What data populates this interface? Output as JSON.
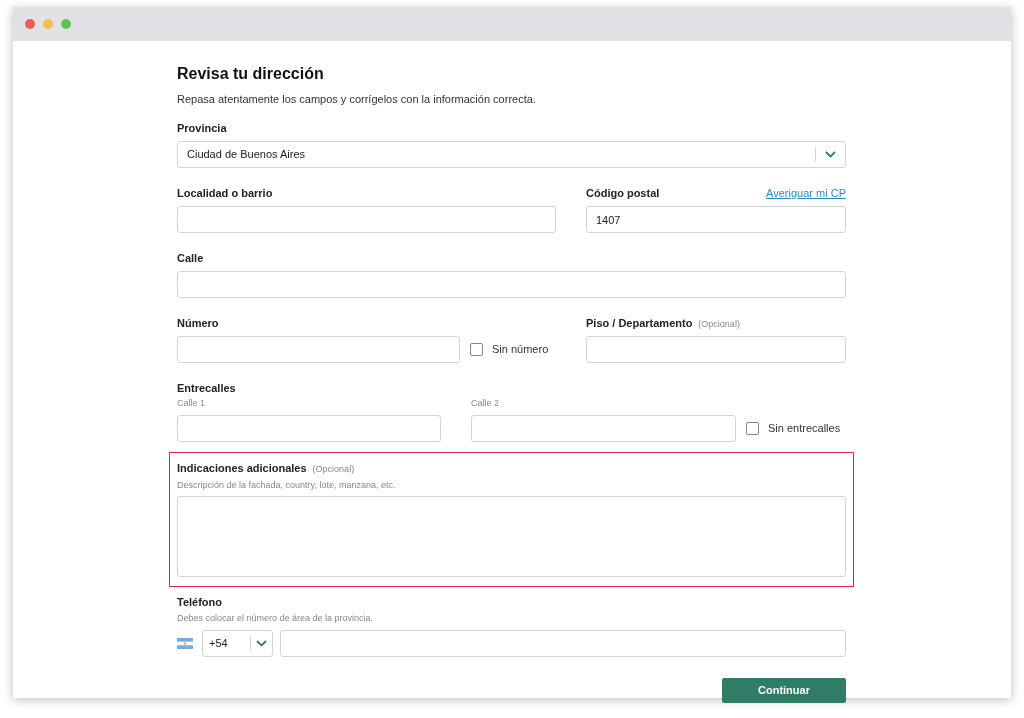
{
  "title": "Revisa tu dirección",
  "subtitle": "Repasa atentamente los campos y corrígelos con la información correcta.",
  "province": {
    "label": "Provincia",
    "value": "Ciudad de Buenos Aires"
  },
  "locality": {
    "label": "Localidad o barrio"
  },
  "postal_code": {
    "label": "Código postal",
    "value": "1407",
    "link": "Averiguar mi CP"
  },
  "street": {
    "label": "Calle"
  },
  "number": {
    "label": "Número",
    "no_number": {
      "label": "Sin número",
      "checked": false
    }
  },
  "floor": {
    "label": "Piso / Departamento",
    "optional": "(Opcional)"
  },
  "cross_streets": {
    "label": "Entrecalles",
    "street_1": "Calle 1",
    "street_2": "Calle 2",
    "none": {
      "label": "Sin entrecalles",
      "checked": false
    }
  },
  "additional": {
    "label": "Indicaciones adicionales",
    "optional": "(Opcional)",
    "hint": "Descripción de la fachada, country, lote, manzana, etc.",
    "highlighted": true
  },
  "phone": {
    "label": "Teléfono",
    "hint": "Debes colocar el número de área de la provincia.",
    "code": "+54"
  },
  "button": "Continuar"
}
